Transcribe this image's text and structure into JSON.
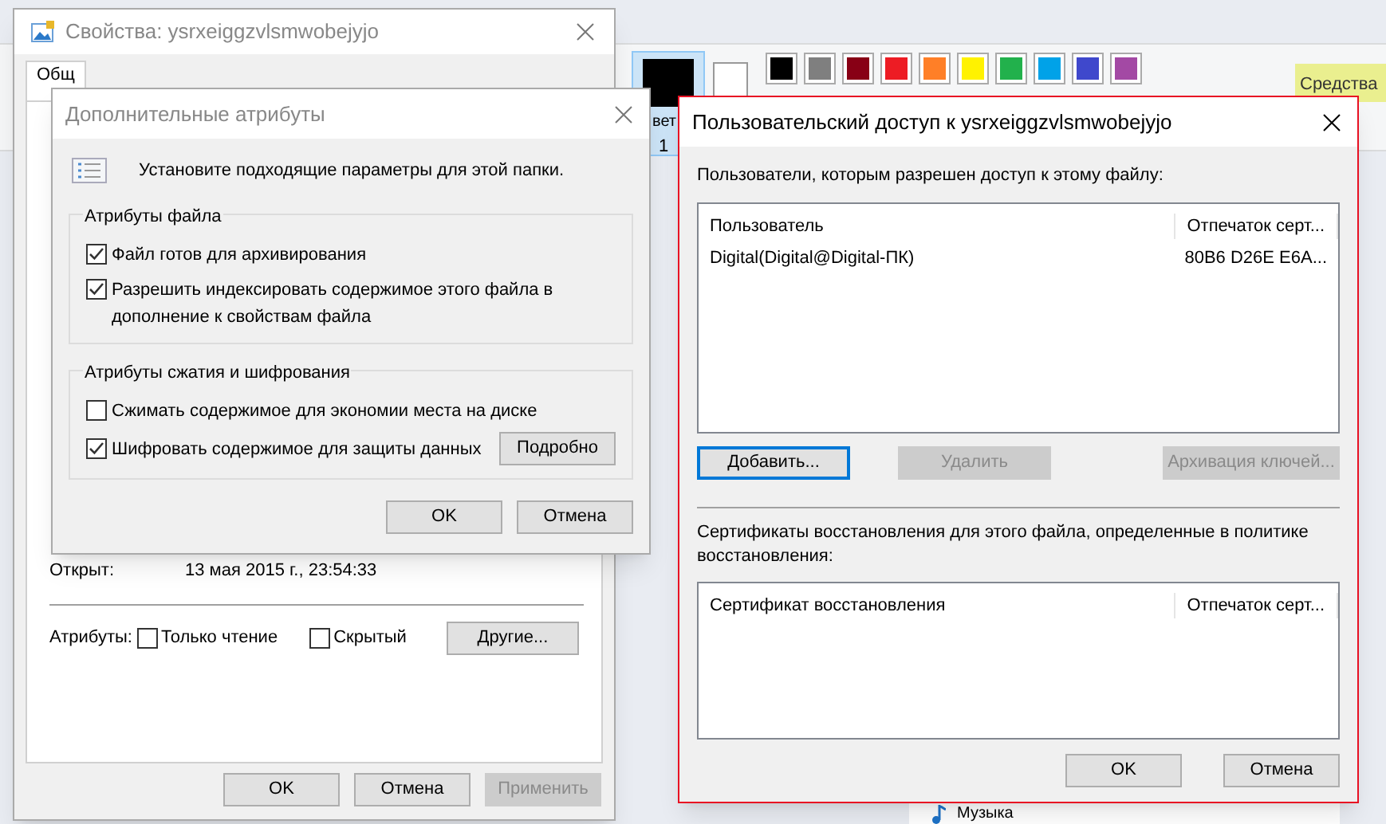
{
  "background": {
    "color_label": [
      "вет",
      "1"
    ],
    "swatches": [
      {
        "color": "#000000"
      },
      {
        "color": "#7f7f7f"
      },
      {
        "color": "#880015"
      },
      {
        "color": "#ed1c24"
      },
      {
        "color": "#ff7f27"
      },
      {
        "color": "#fff200"
      },
      {
        "color": "#22b14c"
      },
      {
        "color": "#00a2e8"
      },
      {
        "color": "#3f48cc"
      },
      {
        "color": "#a349a4"
      }
    ],
    "ribbon_tab": "Средства",
    "nav_item": "Музыка"
  },
  "properties_window": {
    "title": "Свойства: ysrxeiggzvlsmwobejyjo",
    "tabs": [
      {
        "label": "Общ",
        "selected": true
      }
    ],
    "opened": {
      "label": "Открыт:",
      "value": "13 мая 2015 г., 23:54:33"
    },
    "attributes": {
      "label": "Атрибуты:",
      "items": [
        {
          "label": "Только чтение",
          "checked": false
        },
        {
          "label": "Скрытый",
          "checked": false
        }
      ],
      "button": "Другие..."
    },
    "buttons": [
      {
        "label": "OK",
        "disabled": false
      },
      {
        "label": "Отмена",
        "disabled": false
      },
      {
        "label": "Применить",
        "disabled": true
      }
    ]
  },
  "advanced_dialog": {
    "title": "Дополнительные атрибуты",
    "message": "Установите подходящие параметры для этой папки.",
    "groups": [
      {
        "title": "Атрибуты файла",
        "options": [
          {
            "label": "Файл готов для архивирования",
            "checked": true
          },
          {
            "label": "Разрешить индексировать содержимое этого файла в дополнение к свойствам файла",
            "checked": true
          }
        ]
      },
      {
        "title": "Атрибуты сжатия и шифрования",
        "options": [
          {
            "label": "Сжимать содержимое для экономии места на диске",
            "checked": false
          },
          {
            "label": "Шифровать содержимое для защиты данных",
            "checked": true
          }
        ],
        "button": "Подробно"
      }
    ],
    "buttons": [
      {
        "label": "OK"
      },
      {
        "label": "Отмена"
      }
    ]
  },
  "access_dialog": {
    "title": "Пользовательский доступ к ysrxeiggzvlsmwobejyjo",
    "users_label": "Пользователи, которым разрешен доступ к этому файлу:",
    "users_table": {
      "columns": [
        "Пользователь",
        "Отпечаток серт..."
      ],
      "rows": [
        [
          "Digital(Digital@Digital-ПК)",
          "80B6 D26E E6A..."
        ]
      ]
    },
    "list_buttons": [
      {
        "label": "Добавить...",
        "disabled": false,
        "focused": true
      },
      {
        "label": "Удалить",
        "disabled": true,
        "focused": false
      },
      {
        "label": "Архивация ключей...",
        "disabled": true,
        "focused": false
      }
    ],
    "recovery_label": "Сертификаты восстановления для этого файла, определенные в политике восстановления:",
    "recovery_table": {
      "columns": [
        "Сертификат восстановления",
        "Отпечаток серт..."
      ]
    },
    "buttons": [
      {
        "label": "OK"
      },
      {
        "label": "Отмена"
      }
    ]
  }
}
